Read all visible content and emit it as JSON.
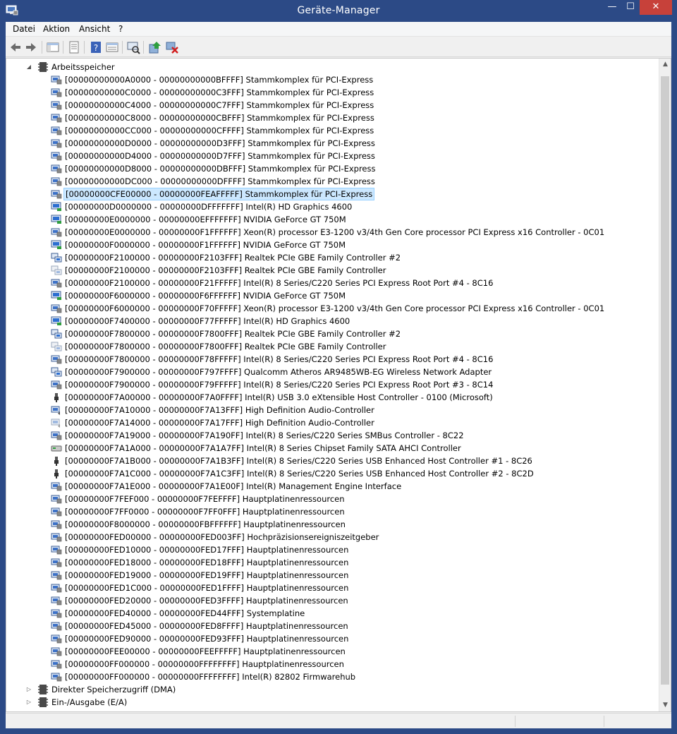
{
  "window": {
    "title": "Geräte-Manager",
    "close_glyph": "✕",
    "min_glyph": "—",
    "max_glyph": "☐"
  },
  "menu": [
    "Datei",
    "Aktion",
    "Ansicht",
    "?"
  ],
  "toolbar": [
    "back-icon",
    "forward-icon",
    "console-tree-icon",
    "properties-icon",
    "help-icon",
    "view-icon",
    "scan-hardware-icon",
    "update-driver-icon",
    "uninstall-icon"
  ],
  "tree": {
    "category": "Arbeitsspeicher",
    "items": [
      {
        "range": "[00000000000A0000 - 00000000000BFFFF]",
        "device": "Stammkomplex für PCI-Express",
        "icon": "system"
      },
      {
        "range": "[00000000000C0000 - 00000000000C3FFF]",
        "device": "Stammkomplex für PCI-Express",
        "icon": "system"
      },
      {
        "range": "[00000000000C4000 - 00000000000C7FFF]",
        "device": "Stammkomplex für PCI-Express",
        "icon": "system"
      },
      {
        "range": "[00000000000C8000 - 00000000000CBFFF]",
        "device": "Stammkomplex für PCI-Express",
        "icon": "system"
      },
      {
        "range": "[00000000000CC000 - 00000000000CFFFF]",
        "device": "Stammkomplex für PCI-Express",
        "icon": "system"
      },
      {
        "range": "[00000000000D0000 - 00000000000D3FFF]",
        "device": "Stammkomplex für PCI-Express",
        "icon": "system"
      },
      {
        "range": "[00000000000D4000 - 00000000000D7FFF]",
        "device": "Stammkomplex für PCI-Express",
        "icon": "system"
      },
      {
        "range": "[00000000000D8000 - 00000000000DBFFF]",
        "device": "Stammkomplex für PCI-Express",
        "icon": "system"
      },
      {
        "range": "[00000000000DC000 - 00000000000DFFFF]",
        "device": "Stammkomplex für PCI-Express",
        "icon": "system"
      },
      {
        "range": "[00000000CFE00000 - 00000000FEAFFFFF]",
        "device": "Stammkomplex für PCI-Express",
        "icon": "system",
        "selected": true
      },
      {
        "range": "[00000000D0000000 - 00000000DFFFFFFF]",
        "device": "Intel(R) HD Graphics 4600",
        "icon": "display"
      },
      {
        "range": "[00000000E0000000 - 00000000EFFFFFFF]",
        "device": "NVIDIA GeForce GT 750M",
        "icon": "display"
      },
      {
        "range": "[00000000E0000000 - 00000000F1FFFFFF]",
        "device": "Xeon(R) processor E3-1200 v3/4th Gen Core processor PCI Express x16 Controller - 0C01",
        "icon": "system"
      },
      {
        "range": "[00000000F0000000 - 00000000F1FFFFFF]",
        "device": "NVIDIA GeForce GT 750M",
        "icon": "display"
      },
      {
        "range": "[00000000F2100000 - 00000000F2103FFF]",
        "device": "Realtek PCIe GBE Family Controller #2",
        "icon": "network"
      },
      {
        "range": "[00000000F2100000 - 00000000F2103FFF]",
        "device": "Realtek PCIe GBE Family Controller",
        "icon": "network-disabled"
      },
      {
        "range": "[00000000F2100000 - 00000000F21FFFFF]",
        "device": "Intel(R) 8 Series/C220 Series PCI Express Root Port #4 - 8C16",
        "icon": "system"
      },
      {
        "range": "[00000000F6000000 - 00000000F6FFFFFF]",
        "device": "NVIDIA GeForce GT 750M",
        "icon": "display"
      },
      {
        "range": "[00000000F6000000 - 00000000F70FFFFF]",
        "device": "Xeon(R) processor E3-1200 v3/4th Gen Core processor PCI Express x16 Controller - 0C01",
        "icon": "system"
      },
      {
        "range": "[00000000F7400000 - 00000000F77FFFFF]",
        "device": "Intel(R) HD Graphics 4600",
        "icon": "display"
      },
      {
        "range": "[00000000F7800000 - 00000000F7800FFF]",
        "device": "Realtek PCIe GBE Family Controller #2",
        "icon": "network"
      },
      {
        "range": "[00000000F7800000 - 00000000F7800FFF]",
        "device": "Realtek PCIe GBE Family Controller",
        "icon": "network-disabled"
      },
      {
        "range": "[00000000F7800000 - 00000000F78FFFFF]",
        "device": "Intel(R) 8 Series/C220 Series PCI Express Root Port #4 - 8C16",
        "icon": "system"
      },
      {
        "range": "[00000000F7900000 - 00000000F797FFFF]",
        "device": "Qualcomm Atheros AR9485WB-EG Wireless Network Adapter",
        "icon": "network"
      },
      {
        "range": "[00000000F7900000 - 00000000F79FFFFF]",
        "device": "Intel(R) 8 Series/C220 Series PCI Express Root Port #3 - 8C14",
        "icon": "system"
      },
      {
        "range": "[00000000F7A00000 - 00000000F7A0FFFF]",
        "device": "Intel(R) USB 3.0 eXtensible Host Controller - 0100 (Microsoft)",
        "icon": "usb"
      },
      {
        "range": "[00000000F7A10000 - 00000000F7A13FFF]",
        "device": "High Definition Audio-Controller",
        "icon": "audio"
      },
      {
        "range": "[00000000F7A14000 - 00000000F7A17FFF]",
        "device": "High Definition Audio-Controller",
        "icon": "audio-disabled"
      },
      {
        "range": "[00000000F7A19000 - 00000000F7A190FF]",
        "device": "Intel(R) 8 Series/C220 Series SMBus Controller - 8C22",
        "icon": "system"
      },
      {
        "range": "[00000000F7A1A000 - 00000000F7A1A7FF]",
        "device": "Intel(R) 8 Series Chipset Family SATA AHCI Controller",
        "icon": "storage"
      },
      {
        "range": "[00000000F7A1B000 - 00000000F7A1B3FF]",
        "device": "Intel(R) 8 Series/C220 Series USB Enhanced Host Controller #1 - 8C26",
        "icon": "usb"
      },
      {
        "range": "[00000000F7A1C000 - 00000000F7A1C3FF]",
        "device": "Intel(R) 8 Series/C220 Series USB Enhanced Host Controller #2 - 8C2D",
        "icon": "usb"
      },
      {
        "range": "[00000000F7A1E000 - 00000000F7A1E00F]",
        "device": "Intel(R) Management Engine Interface",
        "icon": "system"
      },
      {
        "range": "[00000000F7FEF000 - 00000000F7FEFFFF]",
        "device": "Hauptplatinenressourcen",
        "icon": "system"
      },
      {
        "range": "[00000000F7FF0000 - 00000000F7FF0FFF]",
        "device": "Hauptplatinenressourcen",
        "icon": "system"
      },
      {
        "range": "[00000000F8000000 - 00000000FBFFFFFF]",
        "device": "Hauptplatinenressourcen",
        "icon": "system"
      },
      {
        "range": "[00000000FED00000 - 00000000FED003FF]",
        "device": "Hochpräzisionsereigniszeitgeber",
        "icon": "system"
      },
      {
        "range": "[00000000FED10000 - 00000000FED17FFF]",
        "device": "Hauptplatinenressourcen",
        "icon": "system"
      },
      {
        "range": "[00000000FED18000 - 00000000FED18FFF]",
        "device": "Hauptplatinenressourcen",
        "icon": "system"
      },
      {
        "range": "[00000000FED19000 - 00000000FED19FFF]",
        "device": "Hauptplatinenressourcen",
        "icon": "system"
      },
      {
        "range": "[00000000FED1C000 - 00000000FED1FFFF]",
        "device": "Hauptplatinenressourcen",
        "icon": "system"
      },
      {
        "range": "[00000000FED20000 - 00000000FED3FFFF]",
        "device": "Hauptplatinenressourcen",
        "icon": "system"
      },
      {
        "range": "[00000000FED40000 - 00000000FED44FFF]",
        "device": "Systemplatine",
        "icon": "system"
      },
      {
        "range": "[00000000FED45000 - 00000000FED8FFFF]",
        "device": "Hauptplatinenressourcen",
        "icon": "system"
      },
      {
        "range": "[00000000FED90000 - 00000000FED93FFF]",
        "device": "Hauptplatinenressourcen",
        "icon": "system"
      },
      {
        "range": "[00000000FEE00000 - 00000000FEEFFFFF]",
        "device": "Hauptplatinenressourcen",
        "icon": "system"
      },
      {
        "range": "[00000000FF000000 - 00000000FFFFFFFF]",
        "device": "Hauptplatinenressourcen",
        "icon": "system"
      },
      {
        "range": "[00000000FF000000 - 00000000FFFFFFFF]",
        "device": "Intel(R) 82802 Firmwarehub",
        "icon": "system"
      }
    ],
    "collapsed_categories": [
      "Direkter Speicherzugriff (DMA)",
      "Ein-/Ausgabe (E/A)"
    ]
  },
  "colors": {
    "titlebar": "#2c4a86",
    "close_button": "#c7413a",
    "selection": "#cce8ff",
    "selection_border": "#99d1ff"
  }
}
